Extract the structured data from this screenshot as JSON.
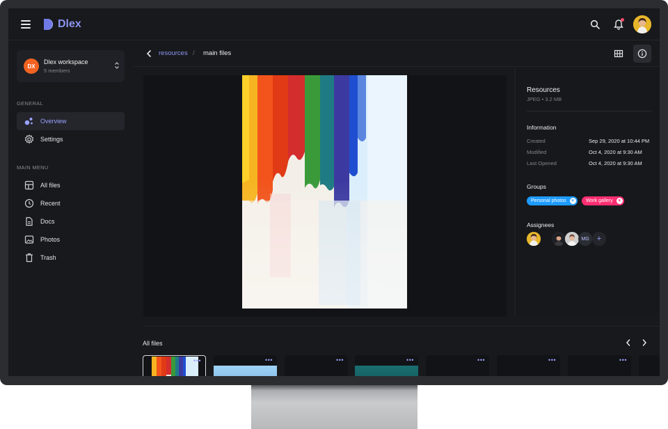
{
  "app": {
    "name": "Dlex"
  },
  "workspace": {
    "badge": "DX",
    "name": "Dlex workspace",
    "members": "5 members"
  },
  "sidebar": {
    "general_title": "GENERAL",
    "general_items": [
      {
        "label": "Overview",
        "icon": "overview-icon",
        "active": true
      },
      {
        "label": "Settings",
        "icon": "gear-icon",
        "active": false
      }
    ],
    "menu_title": "MAIN MENU",
    "menu_items": [
      {
        "label": "All files",
        "icon": "all-files-icon"
      },
      {
        "label": "Recent",
        "icon": "clock-icon"
      },
      {
        "label": "Docs",
        "icon": "document-icon"
      },
      {
        "label": "Photos",
        "icon": "photo-icon"
      },
      {
        "label": "Trash",
        "icon": "trash-icon"
      }
    ]
  },
  "breadcrumb": {
    "parent": "resources",
    "separator": "/",
    "current": "main files"
  },
  "details": {
    "title": "Resources",
    "meta": "JPEG • 3.2 MB",
    "info_title": "Information",
    "info": [
      {
        "label": "Created",
        "value": "Sep 29, 2020 at 10:44 PM"
      },
      {
        "label": "Modified",
        "value": "Oct 4, 2020 at 9:30 AM"
      },
      {
        "label": "Last Opened",
        "value": "Oct 4, 2020 at 9:30 AM"
      }
    ],
    "groups_title": "Groups",
    "groups": [
      {
        "label": "Personal photos",
        "color": "#1e9bff"
      },
      {
        "label": "Work gallery",
        "color": "#ff2e72"
      }
    ],
    "assignees_title": "Assignees",
    "assignee_initials": "MG"
  },
  "files": {
    "title": "All files",
    "thumbs": [
      {
        "kind": "painting",
        "menu": "•••"
      },
      {
        "kind": "sky",
        "menu": "•••"
      },
      {
        "kind": "doc-purple",
        "menu": "•••"
      },
      {
        "kind": "teal",
        "menu": "•••"
      },
      {
        "kind": "doc-purple",
        "menu": "•••"
      },
      {
        "kind": "doc-pink",
        "menu": "•••"
      },
      {
        "kind": "doc-red",
        "menu": "•••"
      }
    ]
  },
  "colors": {
    "accent": "#8a93ef",
    "background": "#18191d",
    "panel": "#202126"
  }
}
